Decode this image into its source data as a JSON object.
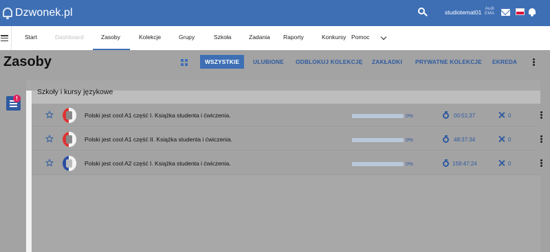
{
  "topbar": {
    "brand": "Dzwonek.pl",
    "username": "studiotemat01",
    "mini_line1": "Audi",
    "mini_line2": "EMA",
    "icons": [
      "search-icon",
      "mail-icon",
      "polish-flag-icon",
      "notification-bell-icon"
    ],
    "color": "#3e6fb5"
  },
  "nav": {
    "items": [
      {
        "label": "Start",
        "state": "normal"
      },
      {
        "label": "Dashboard",
        "state": "disabled"
      },
      {
        "label": "Zasoby",
        "state": "active"
      },
      {
        "label": "Kolekcje",
        "state": "normal"
      },
      {
        "label": "Grupy",
        "state": "normal"
      },
      {
        "label": "Szkoła",
        "state": "normal"
      },
      {
        "label": "Zadania",
        "state": "normal"
      },
      {
        "label": "Raporty",
        "state": "normal"
      },
      {
        "label": "Konkursy",
        "state": "normal"
      },
      {
        "label": "Pomoc",
        "state": "dropdown"
      }
    ]
  },
  "page": {
    "title": "Zasoby",
    "tabs": [
      {
        "label": "WSZYSTKIE",
        "selected": true
      },
      {
        "label": "ULUBIONE",
        "selected": false
      },
      {
        "label": "ODBLOKUJ KOLEKCJĘ",
        "selected": false
      },
      {
        "label": "ZAKŁADKI",
        "selected": false
      },
      {
        "label": "PRYWATNE KOLEKCJE",
        "selected": false
      },
      {
        "label": "EKREDA",
        "selected": false
      }
    ],
    "filter_badge": "!"
  },
  "section": {
    "title": "Szkoły i kursy językowe",
    "rows": [
      {
        "name": "Polski jest cool A1 część I. Książka studenta i ćwiczenia.",
        "progress_percent": 0,
        "progress_label": "0%",
        "time": "00:51:37",
        "count": "0",
        "cover": "red"
      },
      {
        "name": "Polski jest cool A1 część II. Książka studenta i ćwiczenia.",
        "progress_percent": 0,
        "progress_label": "0%",
        "time": "48:37:34",
        "count": "0",
        "cover": "red"
      },
      {
        "name": "Polski jest cool A2 część I. Książka studenta i ćwiczenia.",
        "progress_percent": 0,
        "progress_label": "0%",
        "time": "159:47:24",
        "count": "0",
        "cover": "blue"
      }
    ]
  }
}
